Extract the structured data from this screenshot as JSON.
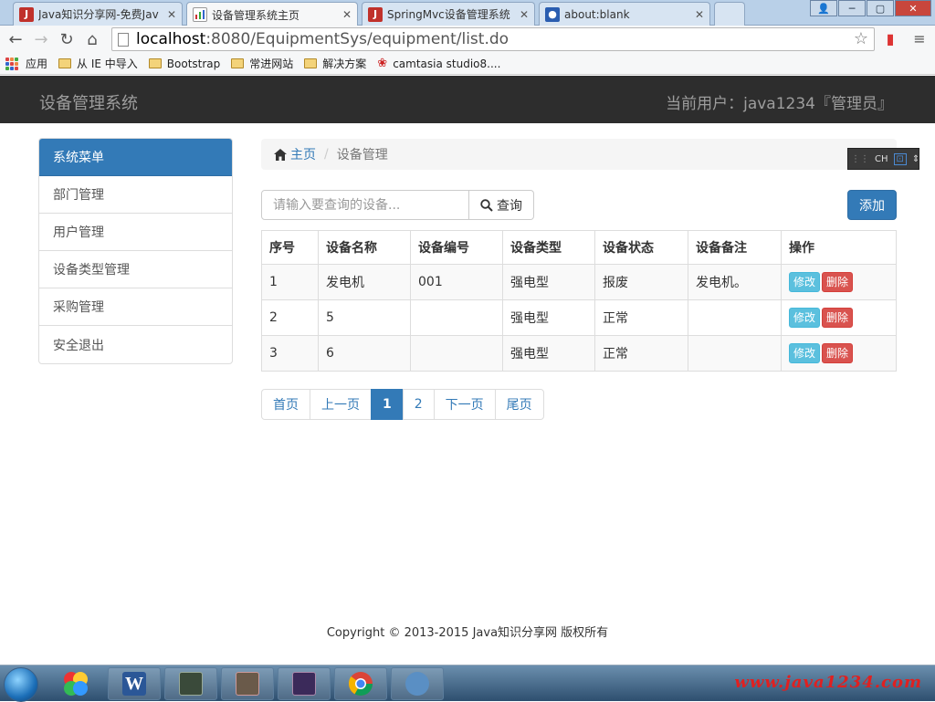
{
  "browser": {
    "tabs": [
      {
        "label": "Java知识分享网-免费Jav",
        "icon": "java-favicon-icon",
        "active": false
      },
      {
        "label": "设备管理系统主页",
        "icon": "page-chart-icon",
        "active": true
      },
      {
        "label": "SpringMvc设备管理系统",
        "icon": "java-favicon-icon",
        "active": false
      },
      {
        "label": "about:blank",
        "icon": "paw-icon",
        "active": false
      }
    ],
    "url_host": "localhost",
    "url_rest": ":8080/EquipmentSys/equipment/list.do",
    "bookmarks": [
      {
        "label": "应用",
        "type": "apps"
      },
      {
        "label": "从 IE 中导入",
        "type": "folder"
      },
      {
        "label": "Bootstrap",
        "type": "folder"
      },
      {
        "label": "常进网站",
        "type": "folder"
      },
      {
        "label": "解决方案",
        "type": "folder"
      },
      {
        "label": "camtasia studio8....",
        "type": "link"
      }
    ]
  },
  "navbar": {
    "brand": "设备管理系统",
    "current_user": "当前用户：java1234『管理员』"
  },
  "sidebar": {
    "header": "系统菜单",
    "items": [
      "部门管理",
      "用户管理",
      "设备类型管理",
      "采购管理",
      "安全退出"
    ]
  },
  "breadcrumb": {
    "home": "主页",
    "current": "设备管理"
  },
  "ime": {
    "label": "CH"
  },
  "search": {
    "placeholder": "请输入要查询的设备...",
    "button": "查询"
  },
  "add_button": "添加",
  "table": {
    "headers": [
      "序号",
      "设备名称",
      "设备编号",
      "设备类型",
      "设备状态",
      "设备备注",
      "操作"
    ],
    "rows": [
      {
        "no": "1",
        "name": "发电机",
        "code": "001",
        "type": "强电型",
        "status": "报废",
        "remark": "发电机。"
      },
      {
        "no": "2",
        "name": "5",
        "code": "",
        "type": "强电型",
        "status": "正常",
        "remark": ""
      },
      {
        "no": "3",
        "name": "6",
        "code": "",
        "type": "强电型",
        "status": "正常",
        "remark": ""
      }
    ],
    "edit_label": "修改",
    "delete_label": "删除"
  },
  "pagination": {
    "first": "首页",
    "prev": "上一页",
    "pages": [
      "1",
      "2"
    ],
    "active": "1",
    "next": "下一页",
    "last": "尾页"
  },
  "footer": "Copyright © 2013-2015 Java知识分享网 版权所有",
  "taskbar": {
    "watermark": "www.java1234.com"
  },
  "colors": {
    "primary": "#337ab7",
    "navbar": "#2d2d2d",
    "info": "#5bc0de",
    "danger": "#d9534f"
  }
}
